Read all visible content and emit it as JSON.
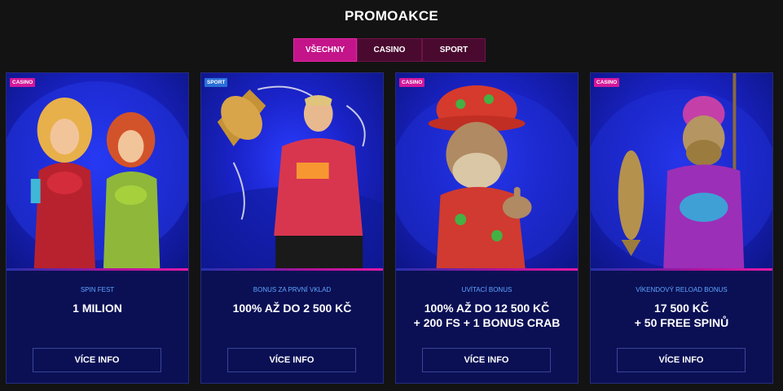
{
  "page": {
    "title": "PROMOAKCE"
  },
  "tabs": [
    {
      "label": "VŠECHNY",
      "active": true
    },
    {
      "label": "CASINO",
      "active": false
    },
    {
      "label": "SPORT",
      "active": false
    }
  ],
  "colors": {
    "accent": "#c4148a",
    "card_bg": "#0b1055",
    "subtitle": "#5ea7ff"
  },
  "cards": [
    {
      "badge": "CASINO",
      "subtitle": "SPIN FEST",
      "headline": "1 MILION",
      "button": "VÍCE INFO",
      "image": "two-women-tropical-drinks"
    },
    {
      "badge": "SPORT",
      "subtitle": "BONUS ZA PRVNÍ VKLAD",
      "headline": "100% AŽ DO 2 500 KČ",
      "button": "VÍCE INFO",
      "image": "athlete-with-trophy"
    },
    {
      "badge": "CASINO",
      "subtitle": "UVÍTACÍ BONUS",
      "headline": "100% AŽ DO 12 500 KČ\n+ 200 FS + 1 BONUS CRAB",
      "button": "VÍCE INFO",
      "image": "old-sailor-thumbs-up"
    },
    {
      "badge": "CASINO",
      "subtitle": "VÍKENDOVÝ RELOAD BONUS",
      "headline": "17 500 KČ\n+ 50 FREE SPINŮ",
      "button": "VÍCE INFO",
      "image": "fisherman-with-fish"
    }
  ]
}
